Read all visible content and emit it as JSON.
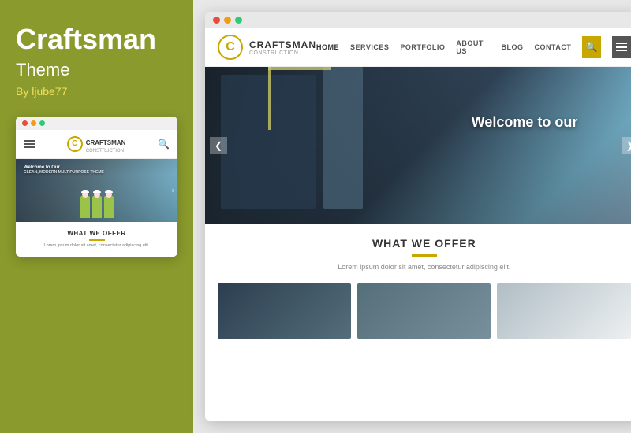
{
  "left": {
    "title": "Craftsman",
    "subtitle": "Theme",
    "author": "By ljube77"
  },
  "mini_preview": {
    "logo_letter": "C",
    "logo_name": "CRAFTSMAN",
    "logo_sub": "CONSTRUCTION",
    "hero_text": "Welcome to Our",
    "hero_sub": "CLEAN, MODERN MULTIPURPOSE THEME",
    "offer_title": "WHAT WE OFFER",
    "offer_text": "Lorem ipsum dolor sit amet, consectetur adipiscing elit."
  },
  "site": {
    "logo_letter": "C",
    "logo_name": "CRAFTSMAN",
    "logo_tagline": "CONSTRUCTION",
    "nav": [
      "HOME",
      "SERVICES",
      "PORTFOLIO",
      "ABOUT US",
      "BLOG",
      "CONTACT"
    ],
    "hero_text": "Welcome to our",
    "offer_title": "WHAT WE OFFER",
    "offer_text": "Lorem ipsum dolor sit amet, consectetur adipiscing elit.",
    "arrow_left": "❮",
    "arrow_right": "❯",
    "search_icon": "🔍"
  },
  "colors": {
    "bg_green": "#8a9a2c",
    "accent_yellow": "#c8a800",
    "text_white": "#ffffff",
    "text_dark": "#333333"
  }
}
